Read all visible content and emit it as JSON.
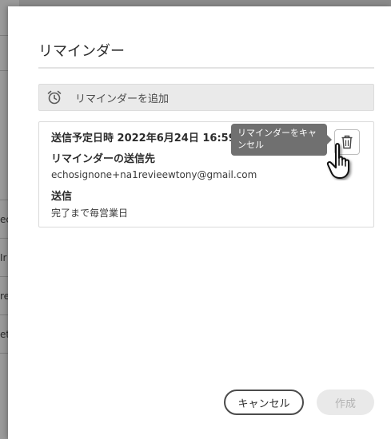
{
  "dialog": {
    "title": "リマインダー",
    "add_reminder_label": "リマインダーを追加",
    "reminder": {
      "scheduled_label": "送信予定日時 2022年6月24日 16:59",
      "recipient_heading": "リマインダーの送信先",
      "recipient_email": "echosignone+na1revieewtony@gmail.com",
      "send_heading": "送信",
      "send_frequency": "完了まで毎営業日",
      "delete_tooltip": "リマインダーをキャンセル"
    },
    "buttons": {
      "cancel": "キャンセル",
      "create": "作成"
    }
  },
  "background_fragments": [
    "ec",
    "Ir",
    "re",
    "et"
  ],
  "icons": {
    "add": "alarm-clock-icon",
    "delete": "trash-icon",
    "pointer": "hand-pointer-cursor"
  },
  "colors": {
    "tooltip_bg": "#707070",
    "add_bar_bg": "#eaeaea",
    "create_disabled_bg": "#e9e9e9"
  }
}
